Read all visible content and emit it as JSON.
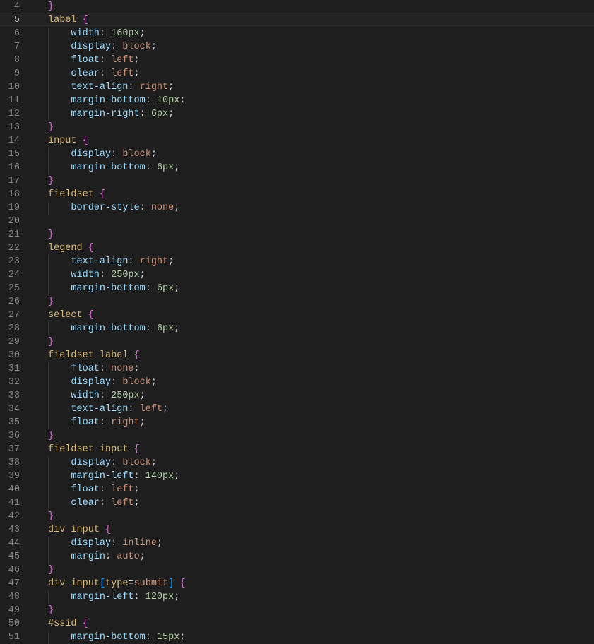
{
  "editor": {
    "startLine": 4,
    "activeLine": 5,
    "lines": [
      {
        "n": 4,
        "indent": 0,
        "raw": [
          [
            "curly",
            "}"
          ]
        ]
      },
      {
        "n": 5,
        "indent": 0,
        "raw": [
          [
            "sel",
            "label"
          ],
          [
            "pun",
            " "
          ],
          [
            "curly",
            "{"
          ]
        ]
      },
      {
        "n": 6,
        "indent": 1,
        "raw": [
          [
            "prop",
            "width"
          ],
          [
            "pun",
            ": "
          ],
          [
            "num",
            "160px"
          ],
          [
            "pun",
            ";"
          ]
        ]
      },
      {
        "n": 7,
        "indent": 1,
        "raw": [
          [
            "prop",
            "display"
          ],
          [
            "pun",
            ": "
          ],
          [
            "kw",
            "block"
          ],
          [
            "pun",
            ";"
          ]
        ]
      },
      {
        "n": 8,
        "indent": 1,
        "raw": [
          [
            "prop",
            "float"
          ],
          [
            "pun",
            ": "
          ],
          [
            "kw",
            "left"
          ],
          [
            "pun",
            ";"
          ]
        ]
      },
      {
        "n": 9,
        "indent": 1,
        "raw": [
          [
            "prop",
            "clear"
          ],
          [
            "pun",
            ": "
          ],
          [
            "kw",
            "left"
          ],
          [
            "pun",
            ";"
          ]
        ]
      },
      {
        "n": 10,
        "indent": 1,
        "raw": [
          [
            "prop",
            "text-align"
          ],
          [
            "pun",
            ": "
          ],
          [
            "kw",
            "right"
          ],
          [
            "pun",
            ";"
          ]
        ]
      },
      {
        "n": 11,
        "indent": 1,
        "raw": [
          [
            "prop",
            "margin-bottom"
          ],
          [
            "pun",
            ": "
          ],
          [
            "num",
            "10px"
          ],
          [
            "pun",
            ";"
          ]
        ]
      },
      {
        "n": 12,
        "indent": 1,
        "raw": [
          [
            "prop",
            "margin-right"
          ],
          [
            "pun",
            ": "
          ],
          [
            "num",
            "6px"
          ],
          [
            "pun",
            ";"
          ]
        ]
      },
      {
        "n": 13,
        "indent": 0,
        "raw": [
          [
            "curly",
            "}"
          ]
        ]
      },
      {
        "n": 14,
        "indent": 0,
        "raw": [
          [
            "sel",
            "input"
          ],
          [
            "pun",
            " "
          ],
          [
            "curly",
            "{"
          ]
        ]
      },
      {
        "n": 15,
        "indent": 1,
        "raw": [
          [
            "prop",
            "display"
          ],
          [
            "pun",
            ": "
          ],
          [
            "kw",
            "block"
          ],
          [
            "pun",
            ";"
          ]
        ]
      },
      {
        "n": 16,
        "indent": 1,
        "raw": [
          [
            "prop",
            "margin-bottom"
          ],
          [
            "pun",
            ": "
          ],
          [
            "num",
            "6px"
          ],
          [
            "pun",
            ";"
          ]
        ]
      },
      {
        "n": 17,
        "indent": 0,
        "raw": [
          [
            "curly",
            "}"
          ]
        ]
      },
      {
        "n": 18,
        "indent": 0,
        "raw": [
          [
            "sel",
            "fieldset"
          ],
          [
            "pun",
            " "
          ],
          [
            "curly",
            "{"
          ]
        ]
      },
      {
        "n": 19,
        "indent": 1,
        "raw": [
          [
            "prop",
            "border-style"
          ],
          [
            "pun",
            ": "
          ],
          [
            "kw",
            "none"
          ],
          [
            "pun",
            ";"
          ]
        ]
      },
      {
        "n": 20,
        "indent": 0,
        "raw": []
      },
      {
        "n": 21,
        "indent": 0,
        "raw": [
          [
            "curly",
            "}"
          ]
        ]
      },
      {
        "n": 22,
        "indent": 0,
        "raw": [
          [
            "sel",
            "legend"
          ],
          [
            "pun",
            " "
          ],
          [
            "curly",
            "{"
          ]
        ]
      },
      {
        "n": 23,
        "indent": 1,
        "raw": [
          [
            "prop",
            "text-align"
          ],
          [
            "pun",
            ": "
          ],
          [
            "kw",
            "right"
          ],
          [
            "pun",
            ";"
          ]
        ]
      },
      {
        "n": 24,
        "indent": 1,
        "raw": [
          [
            "prop",
            "width"
          ],
          [
            "pun",
            ": "
          ],
          [
            "num",
            "250px"
          ],
          [
            "pun",
            ";"
          ]
        ]
      },
      {
        "n": 25,
        "indent": 1,
        "raw": [
          [
            "prop",
            "margin-bottom"
          ],
          [
            "pun",
            ": "
          ],
          [
            "num",
            "6px"
          ],
          [
            "pun",
            ";"
          ]
        ]
      },
      {
        "n": 26,
        "indent": 0,
        "raw": [
          [
            "curly",
            "}"
          ]
        ]
      },
      {
        "n": 27,
        "indent": 0,
        "raw": [
          [
            "sel",
            "select"
          ],
          [
            "pun",
            " "
          ],
          [
            "curly",
            "{"
          ]
        ]
      },
      {
        "n": 28,
        "indent": 1,
        "raw": [
          [
            "prop",
            "margin-bottom"
          ],
          [
            "pun",
            ": "
          ],
          [
            "num",
            "6px"
          ],
          [
            "pun",
            ";"
          ]
        ]
      },
      {
        "n": 29,
        "indent": 0,
        "raw": [
          [
            "curly",
            "}"
          ]
        ]
      },
      {
        "n": 30,
        "indent": 0,
        "raw": [
          [
            "sel",
            "fieldset"
          ],
          [
            "pun",
            " "
          ],
          [
            "sel",
            "label"
          ],
          [
            "pun",
            " "
          ],
          [
            "curly",
            "{"
          ]
        ]
      },
      {
        "n": 31,
        "indent": 1,
        "raw": [
          [
            "prop",
            "float"
          ],
          [
            "pun",
            ": "
          ],
          [
            "kw",
            "none"
          ],
          [
            "pun",
            ";"
          ]
        ]
      },
      {
        "n": 32,
        "indent": 1,
        "raw": [
          [
            "prop",
            "display"
          ],
          [
            "pun",
            ": "
          ],
          [
            "kw",
            "block"
          ],
          [
            "pun",
            ";"
          ]
        ]
      },
      {
        "n": 33,
        "indent": 1,
        "raw": [
          [
            "prop",
            "width"
          ],
          [
            "pun",
            ": "
          ],
          [
            "num",
            "250px"
          ],
          [
            "pun",
            ";"
          ]
        ]
      },
      {
        "n": 34,
        "indent": 1,
        "raw": [
          [
            "prop",
            "text-align"
          ],
          [
            "pun",
            ": "
          ],
          [
            "kw",
            "left"
          ],
          [
            "pun",
            ";"
          ]
        ]
      },
      {
        "n": 35,
        "indent": 1,
        "raw": [
          [
            "prop",
            "float"
          ],
          [
            "pun",
            ": "
          ],
          [
            "kw",
            "right"
          ],
          [
            "pun",
            ";"
          ]
        ]
      },
      {
        "n": 36,
        "indent": 0,
        "raw": [
          [
            "curly",
            "}"
          ]
        ]
      },
      {
        "n": 37,
        "indent": 0,
        "raw": [
          [
            "sel",
            "fieldset"
          ],
          [
            "pun",
            " "
          ],
          [
            "sel",
            "input"
          ],
          [
            "pun",
            " "
          ],
          [
            "curly",
            "{"
          ]
        ]
      },
      {
        "n": 38,
        "indent": 1,
        "raw": [
          [
            "prop",
            "display"
          ],
          [
            "pun",
            ": "
          ],
          [
            "kw",
            "block"
          ],
          [
            "pun",
            ";"
          ]
        ]
      },
      {
        "n": 39,
        "indent": 1,
        "raw": [
          [
            "prop",
            "margin-left"
          ],
          [
            "pun",
            ": "
          ],
          [
            "num",
            "140px"
          ],
          [
            "pun",
            ";"
          ]
        ]
      },
      {
        "n": 40,
        "indent": 1,
        "raw": [
          [
            "prop",
            "float"
          ],
          [
            "pun",
            ": "
          ],
          [
            "kw",
            "left"
          ],
          [
            "pun",
            ";"
          ]
        ]
      },
      {
        "n": 41,
        "indent": 1,
        "raw": [
          [
            "prop",
            "clear"
          ],
          [
            "pun",
            ": "
          ],
          [
            "kw",
            "left"
          ],
          [
            "pun",
            ";"
          ]
        ]
      },
      {
        "n": 42,
        "indent": 0,
        "raw": [
          [
            "curly",
            "}"
          ]
        ]
      },
      {
        "n": 43,
        "indent": 0,
        "raw": [
          [
            "sel",
            "div"
          ],
          [
            "pun",
            " "
          ],
          [
            "sel",
            "input"
          ],
          [
            "pun",
            " "
          ],
          [
            "curly",
            "{"
          ]
        ]
      },
      {
        "n": 44,
        "indent": 1,
        "raw": [
          [
            "prop",
            "display"
          ],
          [
            "pun",
            ": "
          ],
          [
            "kw",
            "inline"
          ],
          [
            "pun",
            ";"
          ]
        ]
      },
      {
        "n": 45,
        "indent": 1,
        "raw": [
          [
            "prop",
            "margin"
          ],
          [
            "pun",
            ": "
          ],
          [
            "kw",
            "auto"
          ],
          [
            "pun",
            ";"
          ]
        ]
      },
      {
        "n": 46,
        "indent": 0,
        "raw": [
          [
            "curly",
            "}"
          ]
        ]
      },
      {
        "n": 47,
        "indent": 0,
        "raw": [
          [
            "sel",
            "div"
          ],
          [
            "pun",
            " "
          ],
          [
            "sel",
            "input"
          ],
          [
            "sqbr",
            "["
          ],
          [
            "attr",
            "type"
          ],
          [
            "pun",
            "="
          ],
          [
            "kw",
            "submit"
          ],
          [
            "sqbr",
            "]"
          ],
          [
            "pun",
            " "
          ],
          [
            "curly",
            "{"
          ]
        ]
      },
      {
        "n": 48,
        "indent": 1,
        "raw": [
          [
            "prop",
            "margin-left"
          ],
          [
            "pun",
            ": "
          ],
          [
            "num",
            "120px"
          ],
          [
            "pun",
            ";"
          ]
        ]
      },
      {
        "n": 49,
        "indent": 0,
        "raw": [
          [
            "curly",
            "}"
          ]
        ]
      },
      {
        "n": 50,
        "indent": 0,
        "raw": [
          [
            "sel",
            "#ssid"
          ],
          [
            "pun",
            " "
          ],
          [
            "curly",
            "{"
          ]
        ]
      },
      {
        "n": 51,
        "indent": 1,
        "raw": [
          [
            "prop",
            "margin-bottom"
          ],
          [
            "pun",
            ": "
          ],
          [
            "num",
            "15px"
          ],
          [
            "pun",
            ";"
          ]
        ]
      }
    ]
  }
}
